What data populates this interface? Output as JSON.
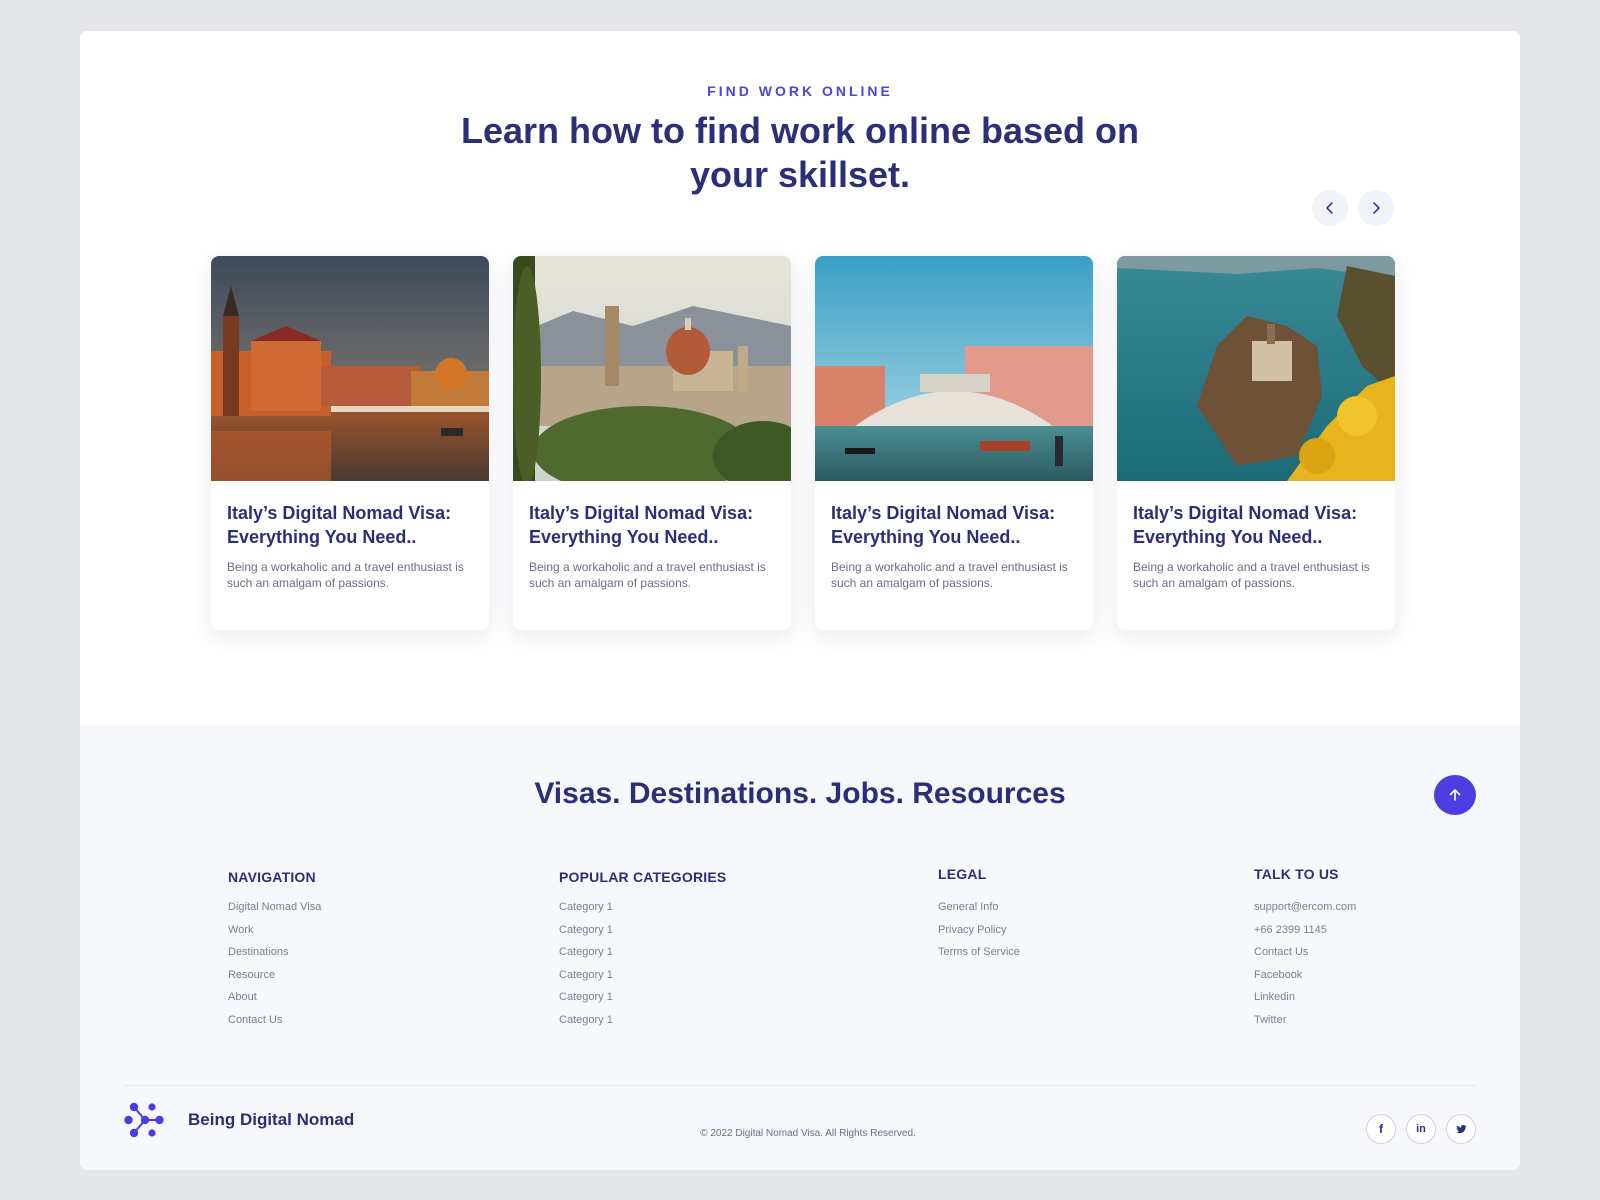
{
  "hero": {
    "eyebrow": "FIND WORK ONLINE",
    "title": "Learn how to find work online based on your skillset."
  },
  "carousel": {
    "prev_icon": "chevron-left-icon",
    "next_icon": "chevron-right-icon"
  },
  "cards": [
    {
      "title": "Italy’s Digital Nomad Visa: Everything You Need..",
      "description": "Being a workaholic and a travel enthusiast is such an amalgam of passions."
    },
    {
      "title": "Italy’s Digital Nomad Visa: Everything You Need..",
      "description": "Being a workaholic and a travel enthusiast is such an amalgam of passions."
    },
    {
      "title": "Italy’s Digital Nomad Visa: Everything You Need..",
      "description": "Being a workaholic and a travel enthusiast is such an amalgam of passions."
    },
    {
      "title": "Italy’s Digital Nomad Visa: Everything You Need..",
      "description": "Being a workaholic and a travel enthusiast is such an amalgam of passions."
    }
  ],
  "footer": {
    "title": "Visas. Destinations. Jobs. Resources",
    "columns": [
      {
        "heading": "NAVIGATION",
        "links": [
          "Digital Nomad Visa",
          "Work",
          "Destinations",
          "Resource",
          "About",
          "Contact Us"
        ]
      },
      {
        "heading": "POPULAR CATEGORIES",
        "links": [
          "Category 1",
          "Category 1",
          "Category 1",
          "Category 1",
          "Category 1",
          "Category 1"
        ]
      },
      {
        "heading": "LEGAL",
        "links": [
          "General Info",
          "Privacy Policy",
          "Terms of Service"
        ]
      },
      {
        "heading": "TALK TO US",
        "links": [
          "support@ercom.com",
          "+66 2399 1145",
          "Contact Us",
          "Facebook",
          "Linkedin",
          "Twitter"
        ]
      }
    ],
    "brand_name": "Being Digital Nomad",
    "copyright": "© 2022 Digital Nomad Visa. All Rights Reserved.",
    "socials": [
      {
        "icon": "facebook-icon",
        "glyph": "f"
      },
      {
        "icon": "linkedin-icon",
        "glyph": "in"
      },
      {
        "icon": "twitter-icon",
        "glyph": "t"
      }
    ]
  },
  "colors": {
    "accent": "#4a3ee0",
    "heading": "#2a2f78",
    "muted": "#7a7f94",
    "footer_bg": "#f7f8fb",
    "page_bg": "#e4e6ea"
  }
}
